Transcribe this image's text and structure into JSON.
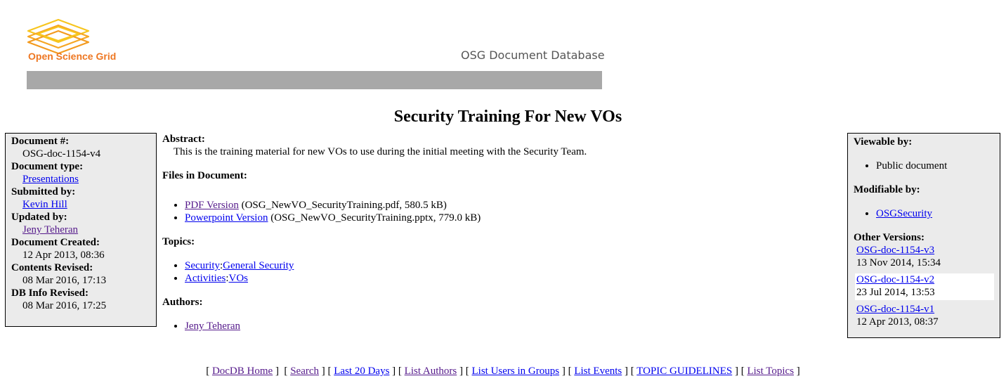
{
  "header": {
    "logo_text": "Open Science Grid",
    "site_title": "OSG Document Database",
    "logo_color": "#ee7722",
    "bar_color": "#a8a8a8"
  },
  "document": {
    "title": "Security Training For New VOs"
  },
  "info": {
    "doc_number_label": "Document #:",
    "doc_number": "OSG-doc-1154-v4",
    "doc_type_label": "Document type:",
    "doc_type": "Presentations",
    "submitted_label": "Submitted by:",
    "submitted_by": "Kevin Hill",
    "updated_label": "Updated by:",
    "updated_by": "Jeny Teheran",
    "created_label": "Document Created:",
    "created": "12 Apr 2013, 08:36",
    "contents_label": "Contents Revised:",
    "contents_revised": "08 Mar 2016, 17:13",
    "dbinfo_label": "DB Info Revised:",
    "dbinfo_revised": "08 Mar 2016, 17:25"
  },
  "main": {
    "abstract_label": "Abstract:",
    "abstract": "This is the training material for new VOs to use during the initial meeting with the Security Team.",
    "files_label": "Files in Document:",
    "files": [
      {
        "link": "PDF Version",
        "detail": "(OSG_NewVO_SecurityTraining.pdf, 580.5 kB)"
      },
      {
        "link": "Powerpoint Version",
        "detail": "(OSG_NewVO_SecurityTraining.pptx, 779.0 kB)"
      }
    ],
    "topics_label": "Topics:",
    "topics": [
      {
        "parent": "Security",
        "sep": ":",
        "child": "General Security"
      },
      {
        "parent": "Activities",
        "sep": ":",
        "child": "VOs"
      }
    ],
    "authors_label": "Authors:",
    "authors": [
      "Jeny Teheran"
    ]
  },
  "access": {
    "viewable_label": "Viewable by:",
    "viewable": "Public document",
    "modifiable_label": "Modifiable by:",
    "modifiable": "OSGSecurity",
    "versions_label": "Other Versions:",
    "versions": [
      {
        "id": "OSG-doc-1154-v3",
        "date": "13 Nov 2014, 15:34"
      },
      {
        "id": "OSG-doc-1154-v2",
        "date": "23 Jul 2014, 13:53"
      },
      {
        "id": "OSG-doc-1154-v1",
        "date": "12 Apr 2013, 08:37"
      }
    ]
  },
  "footer": {
    "links": [
      "DocDB Home",
      "Search",
      "Last 20 Days",
      "List Authors",
      "List Users in Groups",
      "List Events",
      "TOPIC GUIDELINES",
      "List Topics"
    ]
  }
}
